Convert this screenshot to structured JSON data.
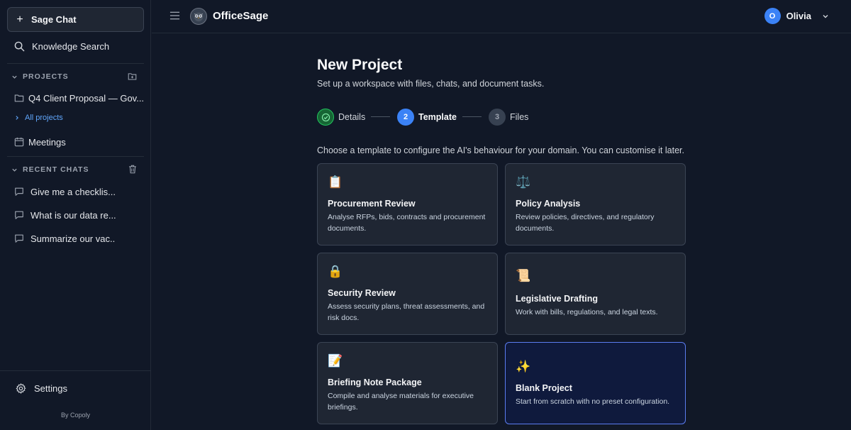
{
  "sidebar": {
    "new_chat_label": "Sage Chat",
    "knowledge_search": "Knowledge Search",
    "projects_heading": "PROJECTS",
    "project_item": "Q4 Client Proposal — Gov...",
    "all_projects": "All projects",
    "meetings": "Meetings",
    "recent_chats_heading": "RECENT CHATS",
    "chats": [
      {
        "label": "Give me a checklis..."
      },
      {
        "label": "What is our data re..."
      },
      {
        "label": "Summarize our vac..."
      }
    ],
    "settings": "Settings",
    "footer": "By Copoly"
  },
  "header": {
    "app_name": "OfficeSage",
    "user_initial": "O",
    "user_name": "Olivia"
  },
  "main": {
    "title": "New Project",
    "subtitle": "Set up a workspace with files, chats, and document tasks.",
    "steps": [
      {
        "number": "1",
        "label": "Details",
        "state": "complete"
      },
      {
        "number": "2",
        "label": "Template",
        "state": "active"
      },
      {
        "number": "3",
        "label": "Files",
        "state": "pending"
      }
    ],
    "intro": "Choose a template to configure the AI's behaviour for your domain. You can customise it later.",
    "templates": [
      {
        "icon": "clipboard-icon",
        "emoji": "📋",
        "title": "Procurement Review",
        "description": "Analyse RFPs, bids, contracts and procurement documents."
      },
      {
        "icon": "scales-icon",
        "emoji": "⚖️",
        "title": "Policy Analysis",
        "description": "Review policies, directives, and regulatory documents."
      },
      {
        "icon": "lock-icon",
        "emoji": "🔒",
        "title": "Security Review",
        "description": "Assess security plans, threat assessments, and risk docs."
      },
      {
        "icon": "scroll-icon",
        "emoji": "📜",
        "title": "Legislative Drafting",
        "description": "Work with bills, regulations, and legal texts."
      },
      {
        "icon": "memo-icon",
        "emoji": "📝",
        "title": "Briefing Note Package",
        "description": "Compile and analyse materials for executive briefings."
      },
      {
        "icon": "sparkles-icon",
        "emoji": "✨",
        "title": "Blank Project",
        "description": "Start from scratch with no preset configuration."
      }
    ]
  },
  "colors": {
    "background": "#111827",
    "card": "#1f2633",
    "accent": "#3b82f6",
    "success": "#22c55e",
    "selected_border": "#5b7cf0"
  }
}
